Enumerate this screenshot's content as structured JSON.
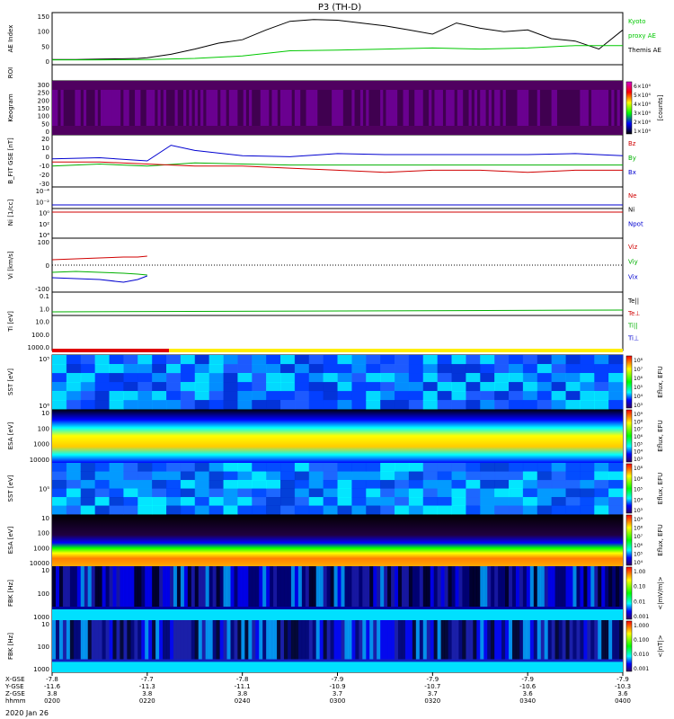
{
  "title": "P3 (TH-D)",
  "date_label": "2020 Jan 26",
  "chart_data": {
    "type": "line",
    "title": "P3 (TH-D)",
    "panels": [
      {
        "id": "ae",
        "ylabel": "AE Index",
        "yticks": [
          "0",
          "50",
          "100",
          "150"
        ],
        "legend": [
          {
            "text": "Kyoto",
            "color": "#00c800"
          },
          {
            "text": "proxy AE",
            "color": "#00c800"
          },
          {
            "text": "Themis AE",
            "color": "#000000"
          }
        ],
        "series": [
          {
            "name": "Themis AE",
            "color": "#000000",
            "x": [
              0,
              5,
              10,
              15,
              18,
              20,
              25,
              30,
              35,
              40,
              45,
              50,
              55,
              60,
              65,
              70,
              75,
              80,
              85,
              90,
              95,
              100,
              105,
              110,
              115,
              120
            ],
            "y": [
              15,
              15,
              16,
              17,
              18,
              20,
              30,
              45,
              62,
              72,
              100,
              125,
              130,
              128,
              120,
              112,
              100,
              88,
              120,
              105,
              95,
              100,
              75,
              68,
              45,
              100
            ]
          },
          {
            "name": "Kyoto proxy AE",
            "color": "#00c800",
            "x": [
              0,
              10,
              20,
              30,
              40,
              50,
              60,
              70,
              80,
              90,
              100,
              110,
              120
            ],
            "y": [
              14,
              14,
              15,
              18,
              25,
              40,
              42,
              45,
              48,
              45,
              48,
              55,
              55
            ]
          }
        ]
      },
      {
        "id": "roi",
        "ylabel": "ROI",
        "yticks": []
      },
      {
        "id": "keogram",
        "ylabel": "Keogram",
        "yticks": [
          "0",
          "50",
          "100",
          "150",
          "200",
          "250",
          "300"
        ],
        "colorbar": {
          "title": "[counts]",
          "labels": [
            "6×10⁴",
            "5×10⁴",
            "4×10⁴",
            "3×10⁴",
            "2×10⁴",
            "1×10⁴"
          ]
        }
      },
      {
        "id": "bfit",
        "ylabel": "B_FIT GSE [nT]",
        "yticks": [
          "-30",
          "-20",
          "-10",
          "0",
          "10",
          "20"
        ],
        "legend": [
          {
            "text": "Bz",
            "color": "#d00000"
          },
          {
            "text": "By",
            "color": "#00b000"
          },
          {
            "text": "Bx",
            "color": "#0000d0"
          }
        ],
        "series": [
          {
            "name": "Bx",
            "color": "#0000d0",
            "x": [
              0,
              10,
              20,
              25,
              30,
              40,
              50,
              60,
              70,
              80,
              90,
              100,
              110,
              120
            ],
            "y": [
              -3,
              -2,
              -5,
              10,
              5,
              0,
              -1,
              2,
              1,
              1,
              1,
              1,
              2,
              0
            ]
          },
          {
            "name": "By",
            "color": "#00b000",
            "x": [
              0,
              10,
              20,
              30,
              40,
              50,
              60,
              70,
              80,
              90,
              100,
              110,
              120
            ],
            "y": [
              -10,
              -8,
              -10,
              -7,
              -8,
              -9,
              -9,
              -9,
              -9,
              -9,
              -9,
              -9,
              -9
            ]
          },
          {
            "name": "Bz",
            "color": "#d00000",
            "x": [
              0,
              10,
              20,
              30,
              40,
              50,
              60,
              70,
              80,
              90,
              100,
              110,
              120
            ],
            "y": [
              -6,
              -6,
              -8,
              -10,
              -10,
              -12,
              -14,
              -16,
              -14,
              -14,
              -16,
              -14,
              -14
            ]
          }
        ]
      },
      {
        "id": "ni",
        "ylabel": "Ni [1/cc]",
        "yticks": [
          "10⁴",
          "10²",
          "10⁰",
          "10⁻²",
          "10⁻⁴"
        ],
        "legend": [
          {
            "text": "Ne",
            "color": "#d00000"
          },
          {
            "text": "Ni",
            "color": "#000000"
          },
          {
            "text": "Npot",
            "color": "#0000d0"
          }
        ]
      },
      {
        "id": "vi",
        "ylabel": "Vi [km/s]",
        "yticks": [
          "-100",
          "0",
          "100"
        ],
        "legend": [
          {
            "text": "Viz",
            "color": "#d00000"
          },
          {
            "text": "Viy",
            "color": "#00b000"
          },
          {
            "text": "Vix",
            "color": "#0000d0"
          }
        ],
        "series": [
          {
            "name": "Vix",
            "color": "#0000d0",
            "x": [
              0,
              5,
              10,
              15,
              18,
              20
            ],
            "y": [
              -70,
              -75,
              -80,
              -95,
              -80,
              -60
            ]
          },
          {
            "name": "Viy",
            "color": "#00b000",
            "x": [
              0,
              5,
              10,
              15,
              18,
              20
            ],
            "y": [
              -40,
              -35,
              -40,
              -45,
              -50,
              -55
            ]
          },
          {
            "name": "Viz",
            "color": "#d00000",
            "x": [
              0,
              5,
              10,
              15,
              18,
              20
            ],
            "y": [
              30,
              35,
              40,
              45,
              45,
              50
            ]
          }
        ]
      },
      {
        "id": "ti",
        "ylabel": "Ti [eV]",
        "yticks": [
          "1000.0",
          "100.0",
          "10.0",
          "1.0",
          "0.1"
        ],
        "legend": [
          {
            "text": "Te||",
            "color": "#000000"
          },
          {
            "text": "Te⊥",
            "color": "#d00000"
          },
          {
            "text": "Ti||",
            "color": "#00b000"
          },
          {
            "text": "Ti⊥",
            "color": "#0000d0"
          }
        ]
      },
      {
        "id": "sst1",
        "ylabel": "SST [eV]",
        "yticks": [
          "10⁶",
          "10⁵"
        ],
        "colorbar": {
          "title": "Eflux, EFU",
          "labels": [
            "10⁸",
            "10⁷",
            "10⁶",
            "10⁵",
            "10⁴",
            "10³"
          ]
        }
      },
      {
        "id": "esa1",
        "ylabel": "ESA [eV]",
        "yticks": [
          "10000",
          "1000",
          "100",
          "10"
        ],
        "colorbar": {
          "title": "Eflux, EFU",
          "labels": [
            "10⁹",
            "10⁸",
            "10⁷",
            "10⁶",
            "10⁵",
            "10⁴",
            "10³"
          ]
        }
      },
      {
        "id": "sst2",
        "ylabel": "SST [eV]",
        "yticks": [
          "10⁵"
        ],
        "colorbar": {
          "title": "Eflux, EFU",
          "labels": [
            "10⁸",
            "10⁶",
            "10⁵",
            "10⁴",
            "10³"
          ]
        }
      },
      {
        "id": "esa2",
        "ylabel": "ESA [eV]",
        "yticks": [
          "10000",
          "1000",
          "100",
          "10"
        ],
        "colorbar": {
          "title": "Eflux, EFU",
          "labels": [
            "10⁹",
            "10⁸",
            "10⁷",
            "10⁶",
            "10⁵",
            "10⁴"
          ]
        }
      },
      {
        "id": "fbk1",
        "ylabel": "FBK [Hz]",
        "yticks": [
          "1000",
          "100",
          "10"
        ],
        "colorbar": {
          "title": "<|mV/m|>",
          "labels": [
            "1.00",
            "0.10",
            "0.01",
            "0.001"
          ]
        }
      },
      {
        "id": "fbk2",
        "ylabel": "FBK [Hz]",
        "yticks": [
          "1000",
          "100",
          "10"
        ],
        "colorbar": {
          "title": "<|nT|>",
          "labels": [
            "1.000",
            "0.100",
            "0.010",
            "0.001"
          ]
        }
      }
    ],
    "xaxis": {
      "row_labels": [
        "X-GSE",
        "Y-GSE",
        "Z-GSE",
        "hhmm"
      ],
      "x_gse": [
        "-7.8",
        "-7.7",
        "-7.8",
        "-7.9",
        "-7.9",
        "-7.9",
        "-7.9"
      ],
      "y_gse": [
        "-11.6",
        "-11.3",
        "-11.1",
        "-10.9",
        "-10.7",
        "-10.6",
        "-10.3"
      ],
      "z_gse": [
        "3.8",
        "3.8",
        "3.8",
        "3.7",
        "3.7",
        "3.6",
        "3.6"
      ],
      "hhmm": [
        "0200",
        "0220",
        "0240",
        "0300",
        "0320",
        "0340",
        "0400"
      ]
    }
  }
}
